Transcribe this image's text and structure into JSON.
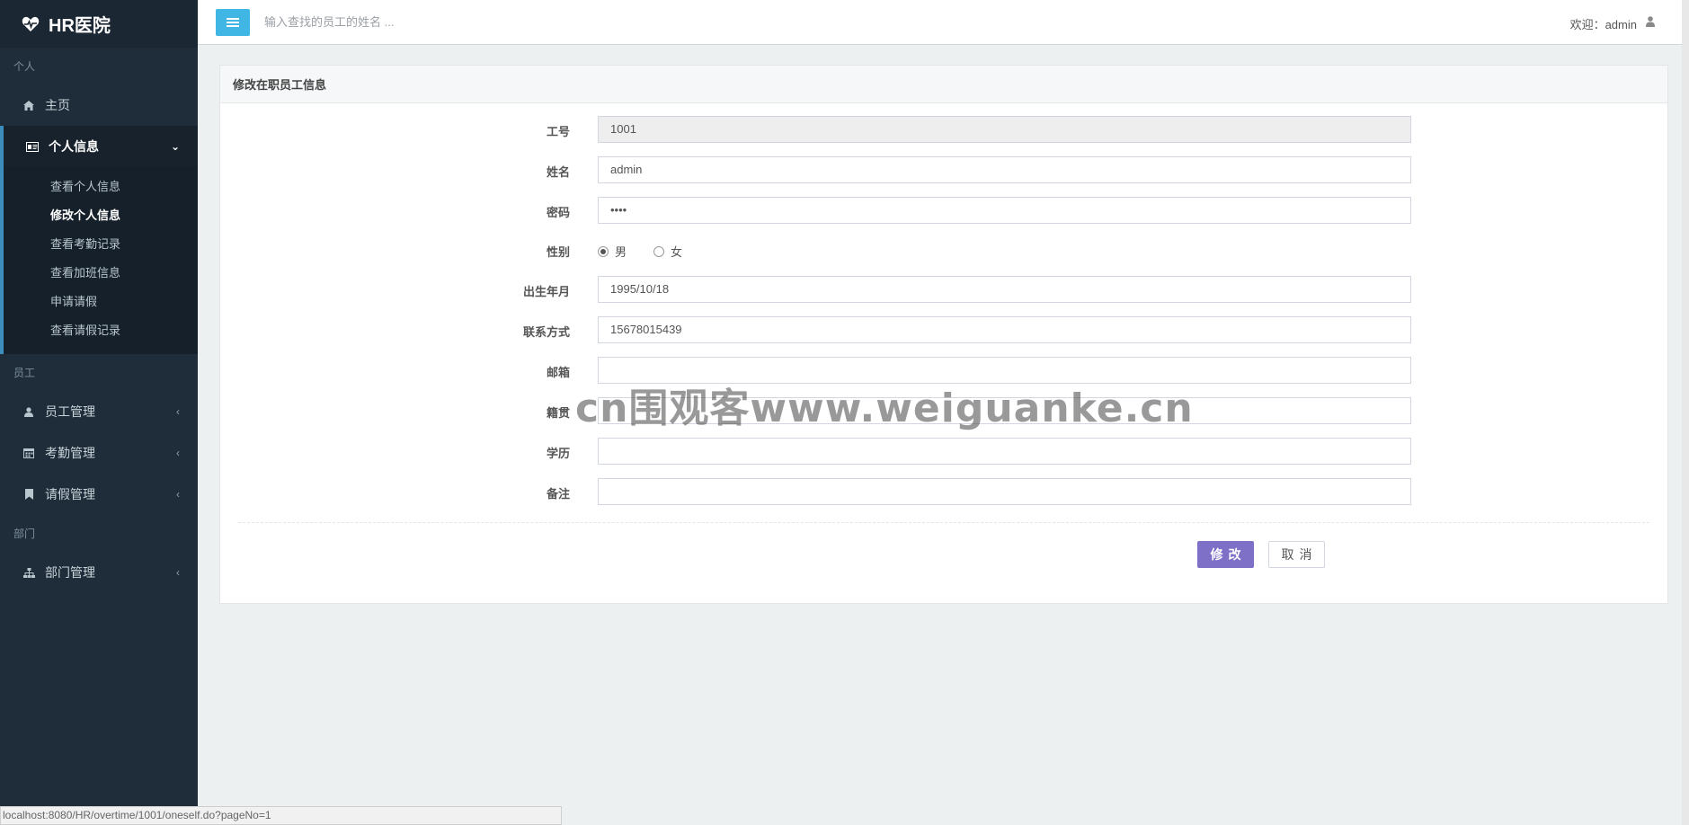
{
  "app": {
    "brand": "HR医院"
  },
  "sidebar": {
    "section_personal": "个人",
    "home": "主页",
    "personal_info": "个人信息",
    "personal_sub": [
      {
        "label": "查看个人信息"
      },
      {
        "label": "修改个人信息"
      },
      {
        "label": "查看考勤记录"
      },
      {
        "label": "查看加班信息"
      },
      {
        "label": "申请请假"
      },
      {
        "label": "查看请假记录"
      }
    ],
    "section_employee": "员工",
    "employee_mgmt": "员工管理",
    "attendance_mgmt": "考勤管理",
    "leave_mgmt": "请假管理",
    "section_dept": "部门",
    "dept_mgmt": "部门管理"
  },
  "topbar": {
    "search_placeholder": "输入查找的员工的姓名 ...",
    "welcome": "欢迎：admin"
  },
  "panel": {
    "title": "修改在职员工信息"
  },
  "form": {
    "id_label": "工号",
    "id_value": "1001",
    "name_label": "姓名",
    "name_value": "admin",
    "password_label": "密码",
    "password_value": "••••",
    "gender_label": "性别",
    "gender_male": "男",
    "gender_female": "女",
    "gender_selected": "男",
    "birth_label": "出生年月",
    "birth_value": "1995/10/18",
    "phone_label": "联系方式",
    "phone_value": "15678015439",
    "email_label": "邮箱",
    "email_value": "",
    "origin_label": "籍贯",
    "origin_value": "",
    "education_label": "学历",
    "education_value": "",
    "notes_label": "备注",
    "notes_value": "",
    "save_label": "修改",
    "cancel_label": "取消"
  },
  "watermark": "cn围观客www.weiguanke.cn",
  "statusbar": {
    "url": "localhost:8080/HR/overtime/1001/oneself.do?pageNo=1"
  },
  "colors": {
    "sidebar_bg": "#1f2d3a",
    "accent_blue": "#3fb6e3",
    "save_purple": "#7e6fc7"
  }
}
